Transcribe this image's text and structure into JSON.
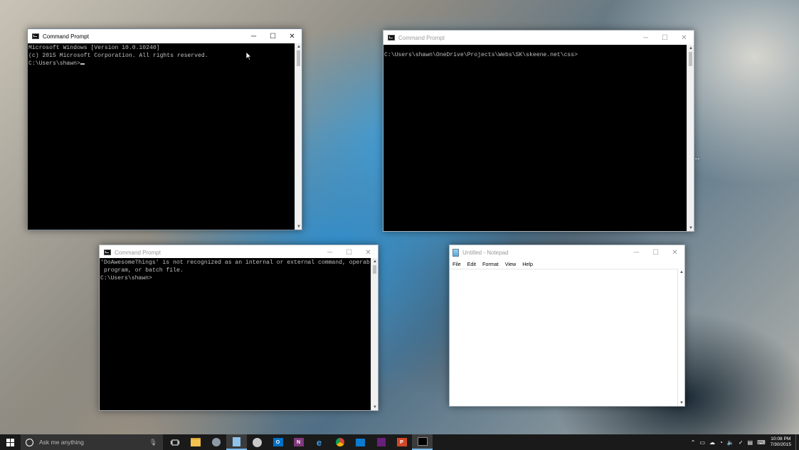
{
  "windows": {
    "cmd1": {
      "title": "Command Prompt",
      "lines": [
        "Microsoft Windows [Version 10.0.10240]",
        "(c) 2015 Microsoft Corporation. All rights reserved.",
        "",
        "C:\\Users\\shawn>"
      ]
    },
    "cmd2": {
      "title": "Command Prompt",
      "lines": [
        "C:\\Users\\shawn\\OneDrive\\Projects\\Webs\\SK\\skeene.net\\css>"
      ]
    },
    "cmd3": {
      "title": "Command Prompt",
      "lines": [
        "'DoAwesomeThings' is not recognized as an internal or external command, operable",
        "program, or batch file.",
        "",
        "C:\\Users\\shawn>"
      ]
    },
    "notepad": {
      "title": "Untitled - Notepad",
      "menu": [
        "File",
        "Edit",
        "Format",
        "View",
        "Help"
      ],
      "content": ""
    }
  },
  "controls": {
    "minimize": "─",
    "maximize": "☐",
    "close": "✕"
  },
  "taskbar": {
    "search_placeholder": "Ask me anything",
    "apps": [
      {
        "name": "file-explorer",
        "color": "#f2c14e"
      },
      {
        "name": "store-settings",
        "color": "#4a90d9"
      },
      {
        "name": "notepad",
        "color": "#8fc3ea"
      },
      {
        "name": "xbox-avatar",
        "color": "#c9c9c9"
      },
      {
        "name": "outlook",
        "color": "#0072c6",
        "label": "O"
      },
      {
        "name": "onenote",
        "color": "#80397b",
        "label": "N"
      },
      {
        "name": "edge",
        "color": "#1e88e5",
        "label": "e"
      },
      {
        "name": "chrome",
        "color": "#4caf50"
      },
      {
        "name": "photos",
        "color": "#0a7bd1"
      },
      {
        "name": "visual-studio",
        "color": "#68217a"
      },
      {
        "name": "powerpoint",
        "color": "#d24726",
        "label": "P"
      },
      {
        "name": "command-prompt",
        "color": "#000000"
      }
    ],
    "time": "10:08 PM",
    "date": "7/30/2015"
  }
}
